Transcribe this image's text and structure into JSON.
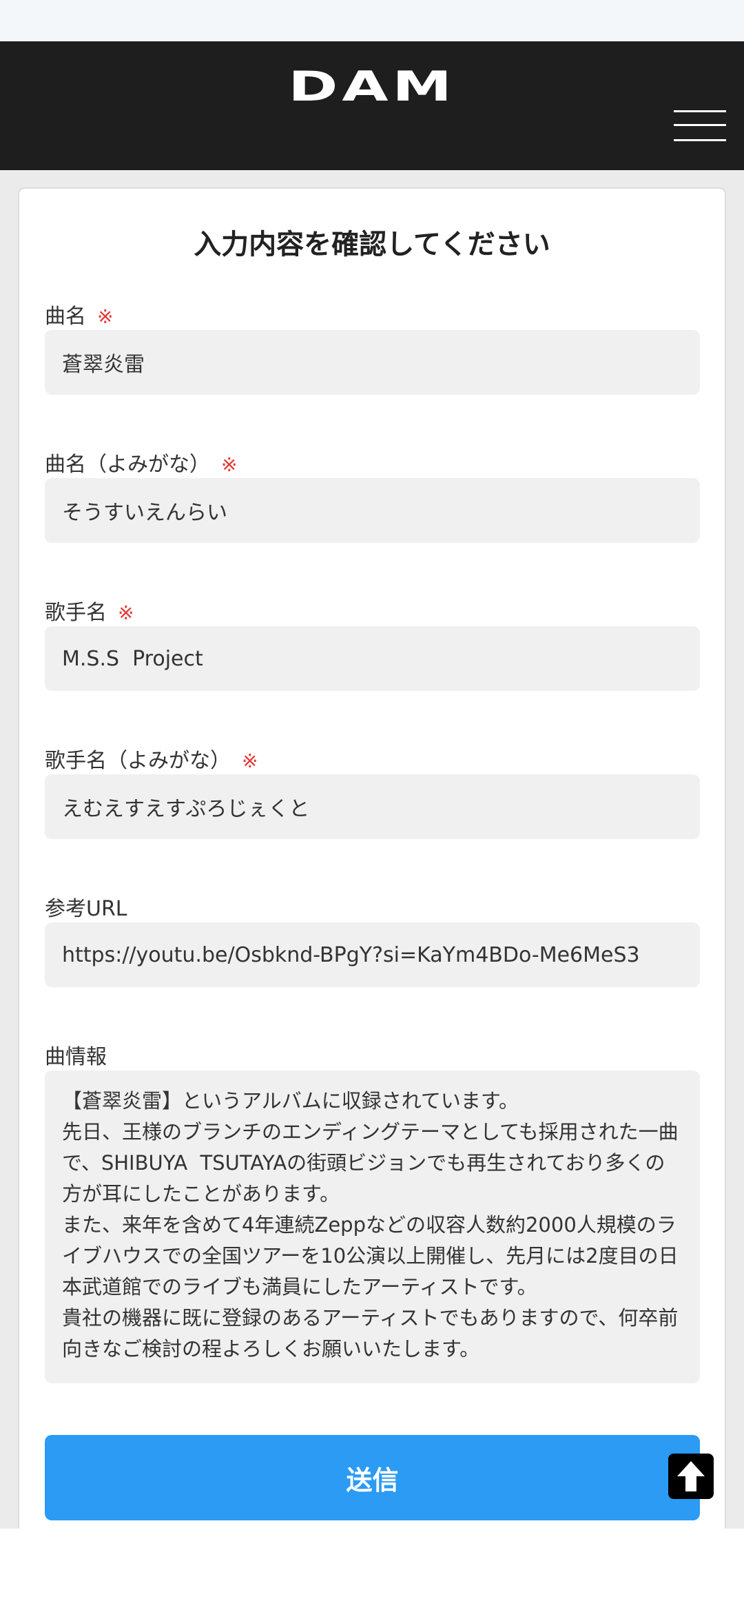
{
  "header": {
    "logo_text": "DAM",
    "menu_icon": "hamburger-menu-icon"
  },
  "form": {
    "title": "入力内容を確認してください",
    "required_mark": "※",
    "fields": [
      {
        "label": "曲名",
        "value": "蒼翠炎雷",
        "required": true
      },
      {
        "label": "曲名（よみがな）",
        "value": "そうすいえんらい",
        "required": true
      },
      {
        "label": "歌手名",
        "value": "M.S.S  Project",
        "required": true
      },
      {
        "label": "歌手名（よみがな）",
        "value": "えむえすえすぷろじぇくと",
        "required": true
      },
      {
        "label": "参考URL",
        "value": "https://youtu.be/Osbknd-BPgY?si=KaYm4BDo-Me6MeS3",
        "required": false
      },
      {
        "label": "曲情報",
        "value": "【蒼翠炎雷】というアルバムに収録されています。\n先日、王様のブランチのエンディングテーマとしても採用された一曲で、SHIBUYA  TSUTAYAの街頭ビジョンでも再生されており多くの方が耳にしたことがあります。\nまた、来年を含めて4年連続Zeppなどの収容人数約2000人規模のライブハウスでの全国ツアーを10公演以上開催し、先月には2度目の日本武道館でのライブも満員にしたアーティストです。\n貴社の機器に既に登録のあるアーティストでもありますので、何卒前向きなご検討の程よろしくお願いいたします。",
        "required": false
      }
    ],
    "submit_label": "送信"
  },
  "scroll_top_icon": "arrow-up-icon",
  "colors": {
    "header_bg": "#1e1e1e",
    "accent": "#2b9bf4",
    "required": "#e53935",
    "field_bg": "#f0f0f0"
  }
}
